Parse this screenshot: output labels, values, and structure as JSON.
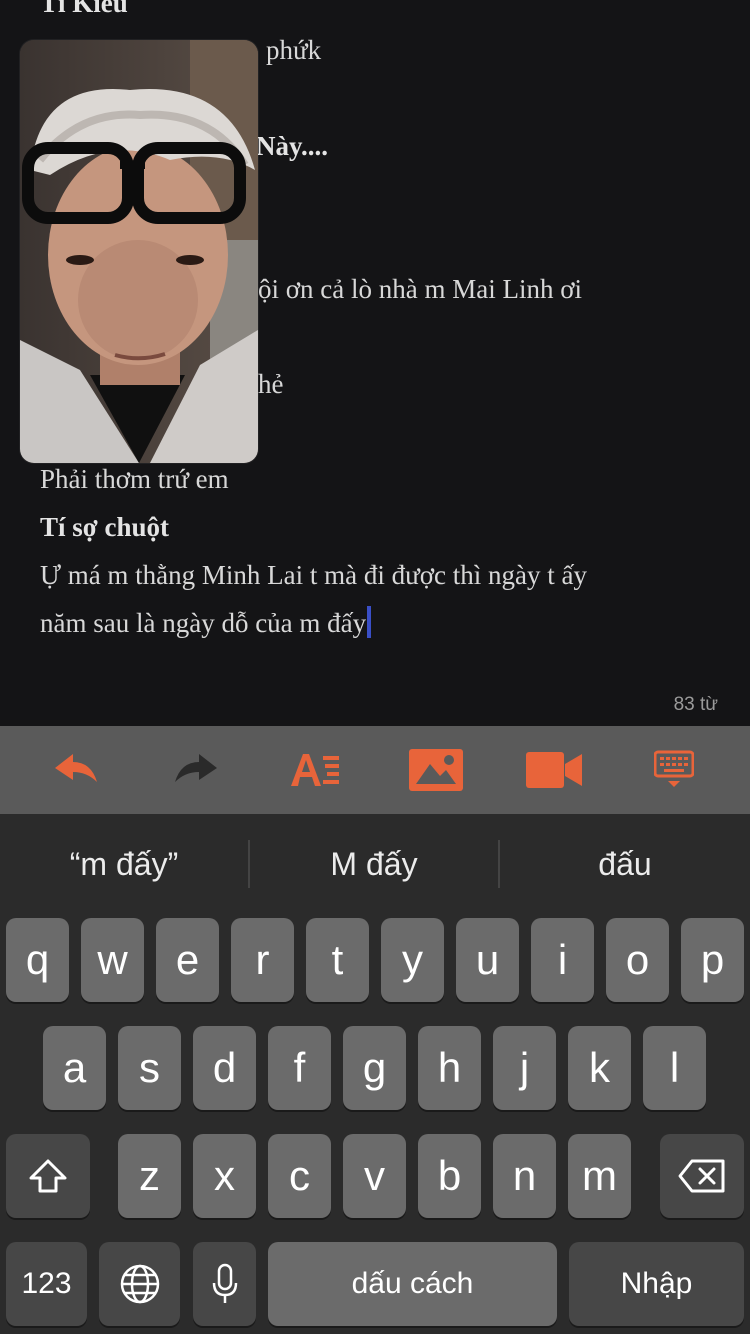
{
  "note": {
    "lines": [
      {
        "text": "Tí Kiều",
        "bold": true
      },
      {
        "text": "phứk",
        "bold": false
      },
      {
        "text": "Này....",
        "bold": true
      },
      {
        "text": "ội ơn cả lò nhà m Mai Linh ơi",
        "bold": false
      },
      {
        "text": "hẻ",
        "bold": false
      },
      {
        "text": "Phải thơm trứ em",
        "bold": false
      },
      {
        "text": "Tí sợ chuột",
        "bold": true
      },
      {
        "text": "Ự má m thằng Minh Lai t mà đi được thì ngày t ấy",
        "bold": false
      },
      {
        "text": "năm sau là ngày dỗ của m đấy",
        "bold": false
      }
    ],
    "word_count": "83 từ"
  },
  "video_call": {
    "icon": "person-video-feed"
  },
  "toolbar": {
    "accent": "#e8643a",
    "buttons": [
      "undo-icon",
      "redo-icon",
      "text-format-icon",
      "insert-image-icon",
      "video-camera-icon",
      "keyboard-dismiss-icon"
    ]
  },
  "keyboard": {
    "suggestions": [
      "“m đấy”",
      "M đấy",
      "đấu"
    ],
    "row1": [
      "q",
      "w",
      "e",
      "r",
      "t",
      "y",
      "u",
      "i",
      "o",
      "p"
    ],
    "row2": [
      "a",
      "s",
      "d",
      "f",
      "g",
      "h",
      "j",
      "k",
      "l"
    ],
    "row3": [
      "z",
      "x",
      "c",
      "v",
      "b",
      "n",
      "m"
    ],
    "numbers_key": "123",
    "space_key": "dấu cách",
    "return_key": "Nhập"
  }
}
